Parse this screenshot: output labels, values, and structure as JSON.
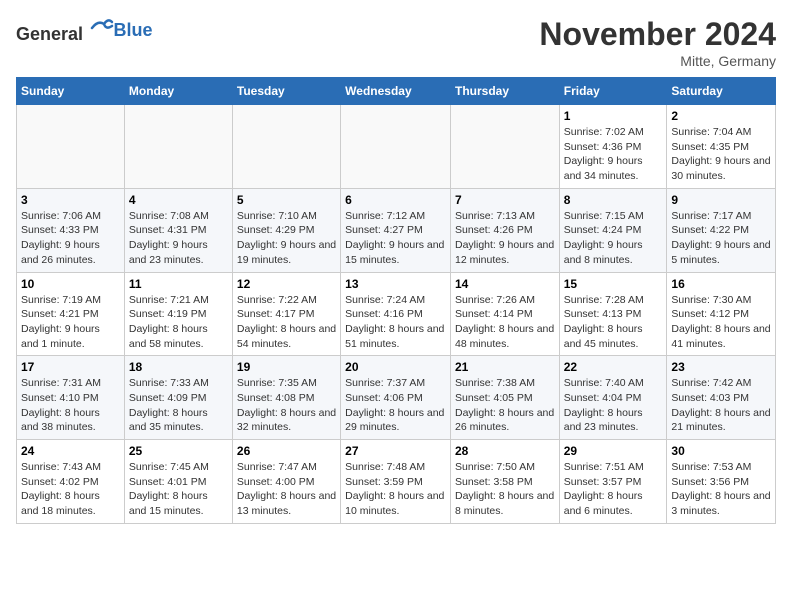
{
  "header": {
    "logo_general": "General",
    "logo_blue": "Blue",
    "title": "November 2024",
    "location": "Mitte, Germany"
  },
  "weekdays": [
    "Sunday",
    "Monday",
    "Tuesday",
    "Wednesday",
    "Thursday",
    "Friday",
    "Saturday"
  ],
  "weeks": [
    [
      {
        "day": "",
        "info": ""
      },
      {
        "day": "",
        "info": ""
      },
      {
        "day": "",
        "info": ""
      },
      {
        "day": "",
        "info": ""
      },
      {
        "day": "",
        "info": ""
      },
      {
        "day": "1",
        "info": "Sunrise: 7:02 AM\nSunset: 4:36 PM\nDaylight: 9 hours and 34 minutes."
      },
      {
        "day": "2",
        "info": "Sunrise: 7:04 AM\nSunset: 4:35 PM\nDaylight: 9 hours and 30 minutes."
      }
    ],
    [
      {
        "day": "3",
        "info": "Sunrise: 7:06 AM\nSunset: 4:33 PM\nDaylight: 9 hours and 26 minutes."
      },
      {
        "day": "4",
        "info": "Sunrise: 7:08 AM\nSunset: 4:31 PM\nDaylight: 9 hours and 23 minutes."
      },
      {
        "day": "5",
        "info": "Sunrise: 7:10 AM\nSunset: 4:29 PM\nDaylight: 9 hours and 19 minutes."
      },
      {
        "day": "6",
        "info": "Sunrise: 7:12 AM\nSunset: 4:27 PM\nDaylight: 9 hours and 15 minutes."
      },
      {
        "day": "7",
        "info": "Sunrise: 7:13 AM\nSunset: 4:26 PM\nDaylight: 9 hours and 12 minutes."
      },
      {
        "day": "8",
        "info": "Sunrise: 7:15 AM\nSunset: 4:24 PM\nDaylight: 9 hours and 8 minutes."
      },
      {
        "day": "9",
        "info": "Sunrise: 7:17 AM\nSunset: 4:22 PM\nDaylight: 9 hours and 5 minutes."
      }
    ],
    [
      {
        "day": "10",
        "info": "Sunrise: 7:19 AM\nSunset: 4:21 PM\nDaylight: 9 hours and 1 minute."
      },
      {
        "day": "11",
        "info": "Sunrise: 7:21 AM\nSunset: 4:19 PM\nDaylight: 8 hours and 58 minutes."
      },
      {
        "day": "12",
        "info": "Sunrise: 7:22 AM\nSunset: 4:17 PM\nDaylight: 8 hours and 54 minutes."
      },
      {
        "day": "13",
        "info": "Sunrise: 7:24 AM\nSunset: 4:16 PM\nDaylight: 8 hours and 51 minutes."
      },
      {
        "day": "14",
        "info": "Sunrise: 7:26 AM\nSunset: 4:14 PM\nDaylight: 8 hours and 48 minutes."
      },
      {
        "day": "15",
        "info": "Sunrise: 7:28 AM\nSunset: 4:13 PM\nDaylight: 8 hours and 45 minutes."
      },
      {
        "day": "16",
        "info": "Sunrise: 7:30 AM\nSunset: 4:12 PM\nDaylight: 8 hours and 41 minutes."
      }
    ],
    [
      {
        "day": "17",
        "info": "Sunrise: 7:31 AM\nSunset: 4:10 PM\nDaylight: 8 hours and 38 minutes."
      },
      {
        "day": "18",
        "info": "Sunrise: 7:33 AM\nSunset: 4:09 PM\nDaylight: 8 hours and 35 minutes."
      },
      {
        "day": "19",
        "info": "Sunrise: 7:35 AM\nSunset: 4:08 PM\nDaylight: 8 hours and 32 minutes."
      },
      {
        "day": "20",
        "info": "Sunrise: 7:37 AM\nSunset: 4:06 PM\nDaylight: 8 hours and 29 minutes."
      },
      {
        "day": "21",
        "info": "Sunrise: 7:38 AM\nSunset: 4:05 PM\nDaylight: 8 hours and 26 minutes."
      },
      {
        "day": "22",
        "info": "Sunrise: 7:40 AM\nSunset: 4:04 PM\nDaylight: 8 hours and 23 minutes."
      },
      {
        "day": "23",
        "info": "Sunrise: 7:42 AM\nSunset: 4:03 PM\nDaylight: 8 hours and 21 minutes."
      }
    ],
    [
      {
        "day": "24",
        "info": "Sunrise: 7:43 AM\nSunset: 4:02 PM\nDaylight: 8 hours and 18 minutes."
      },
      {
        "day": "25",
        "info": "Sunrise: 7:45 AM\nSunset: 4:01 PM\nDaylight: 8 hours and 15 minutes."
      },
      {
        "day": "26",
        "info": "Sunrise: 7:47 AM\nSunset: 4:00 PM\nDaylight: 8 hours and 13 minutes."
      },
      {
        "day": "27",
        "info": "Sunrise: 7:48 AM\nSunset: 3:59 PM\nDaylight: 8 hours and 10 minutes."
      },
      {
        "day": "28",
        "info": "Sunrise: 7:50 AM\nSunset: 3:58 PM\nDaylight: 8 hours and 8 minutes."
      },
      {
        "day": "29",
        "info": "Sunrise: 7:51 AM\nSunset: 3:57 PM\nDaylight: 8 hours and 6 minutes."
      },
      {
        "day": "30",
        "info": "Sunrise: 7:53 AM\nSunset: 3:56 PM\nDaylight: 8 hours and 3 minutes."
      }
    ]
  ]
}
